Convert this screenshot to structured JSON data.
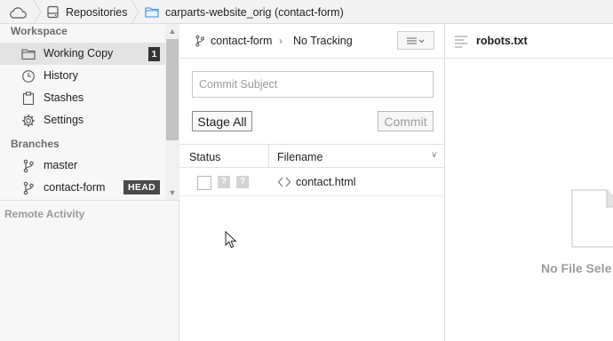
{
  "breadcrumb": {
    "home_icon": "cloud-icon",
    "repositories_label": "Repositories",
    "repositories_icon": "drive-icon",
    "repo_label": "carparts-website_orig (contact-form)",
    "repo_icon": "folder-icon"
  },
  "sidebar": {
    "workspace_title": "Workspace",
    "workspace_items": [
      {
        "label": "Working Copy",
        "icon": "folder-icon",
        "badge": "1",
        "selected": true
      },
      {
        "label": "History",
        "icon": "clock-icon"
      },
      {
        "label": "Stashes",
        "icon": "clipboard-icon"
      },
      {
        "label": "Settings",
        "icon": "gear-icon"
      }
    ],
    "branches_title": "Branches",
    "branch_items": [
      {
        "label": "master",
        "icon": "branch-icon"
      },
      {
        "label": "contact-form",
        "icon": "branch-icon",
        "badge": "HEAD"
      }
    ],
    "remote_title": "Remote Activity"
  },
  "commit_panel": {
    "branch": "contact-form",
    "tracking": "No Tracking",
    "subject_placeholder": "Commit Subject",
    "stage_all_label": "Stage All",
    "commit_label": "Commit",
    "columns": {
      "status": "Status",
      "filename": "Filename"
    },
    "files": [
      {
        "name": "contact.html",
        "staged": false,
        "status_flags": [
          "?",
          "?"
        ],
        "icon": "code-icon"
      }
    ]
  },
  "file_panel": {
    "title": "robots.txt",
    "empty_message": "No File Sele"
  },
  "colors": {
    "sidebar_bg": "#f7f7f7",
    "selection_bg": "#e3e3e3",
    "badge_bg": "#333333",
    "folder_blue": "#3b8ed6"
  }
}
